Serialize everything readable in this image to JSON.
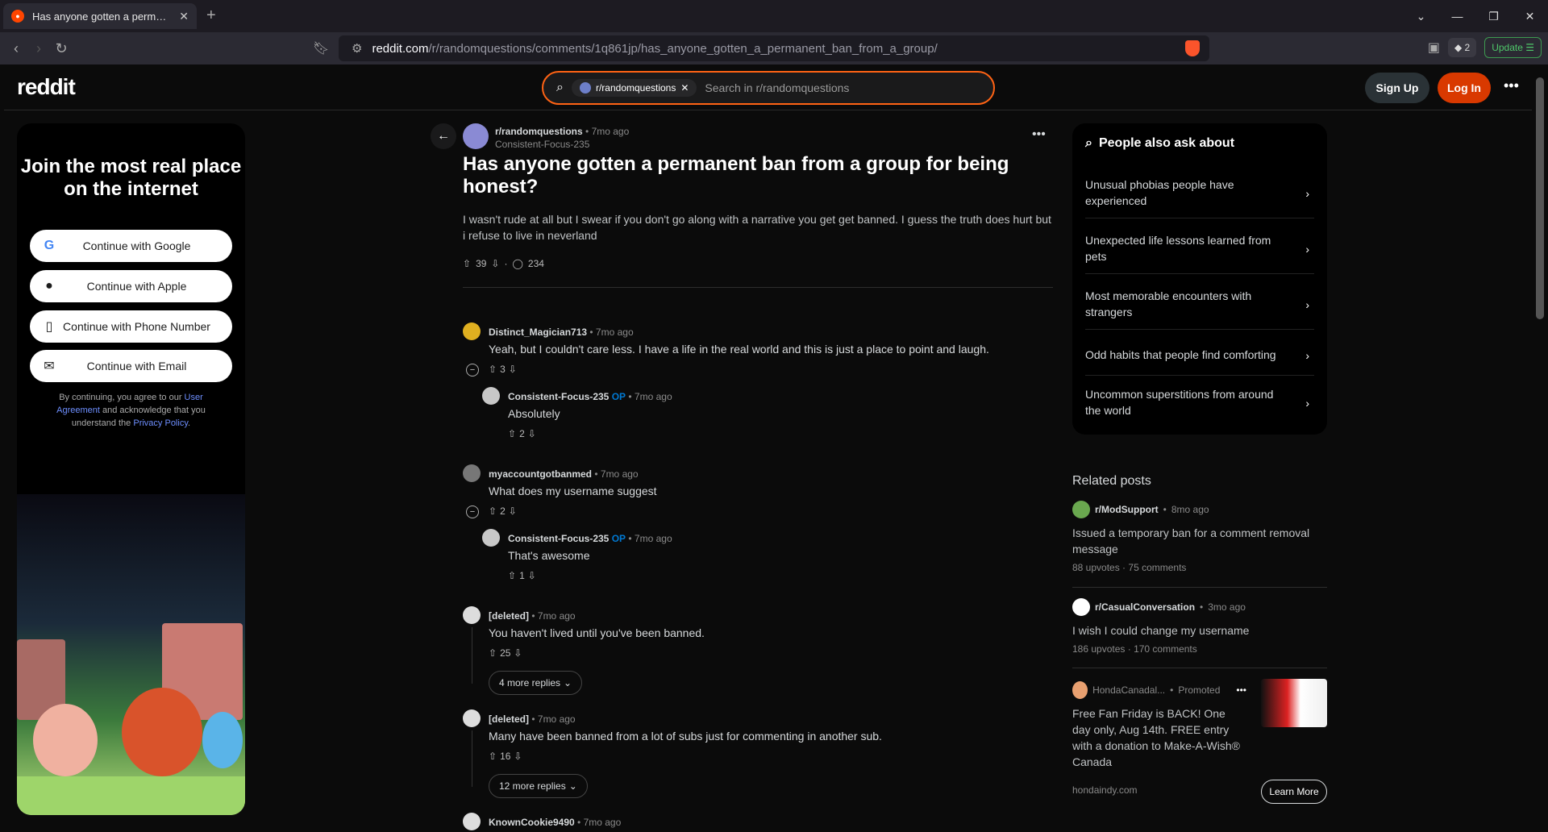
{
  "browser": {
    "tab_title": "Has anyone gotten a permanent ban from a group for being honest?",
    "url_host": "reddit.com",
    "url_path": "/r/randomquestions/comments/1q861jp/has_anyone_gotten_a_permanent_ban_from_a_group/",
    "new_tab": "+",
    "close_tab": "✕",
    "shield_count": "2",
    "update_label": "Update"
  },
  "header": {
    "logo": "reddit",
    "search_subreddit": "r/randomquestions",
    "search_placeholder": "Search in r/randomquestions",
    "signup": "Sign Up",
    "login": "Log In"
  },
  "promo": {
    "heading": "Join the most real place on the internet",
    "buttons": [
      {
        "label": "Continue with Google",
        "icon": "google-icon"
      },
      {
        "label": "Continue with Apple",
        "icon": "apple-icon"
      },
      {
        "label": "Continue with Phone Number",
        "icon": "phone-icon"
      },
      {
        "label": "Continue with Email",
        "icon": "email-icon"
      }
    ],
    "agree_prefix": "By continuing, you agree to our ",
    "agree_link1": "User Agreement",
    "agree_mid": " and acknowledge that you understand the ",
    "agree_link2": "Privacy Policy",
    "agree_suffix": "."
  },
  "post": {
    "subreddit": "r/randomquestions",
    "time": "7mo ago",
    "author": "Consistent-Focus-235",
    "title": "Has anyone gotten a permanent ban from a group for being honest?",
    "body": "I wasn't rude at all but I swear if you don't go along with a narrative you get get banned. I guess the truth does hurt but i refuse to live in neverland",
    "votes": "39",
    "comments": "234"
  },
  "comments": [
    {
      "author": "Distinct_Magician713",
      "time": "7mo ago",
      "op": "",
      "text": "Yeah, but I couldn't care less. I have a life in the real world and this is just a place to point and laugh.",
      "votes": "3"
    },
    {
      "author": "Consistent-Focus-235",
      "time": "7mo ago",
      "op": "OP",
      "text": "Absolutely",
      "votes": "2"
    },
    {
      "author": "myaccountgotbanmed",
      "time": "7mo ago",
      "op": "",
      "text": "What does my username suggest",
      "votes": "2"
    },
    {
      "author": "Consistent-Focus-235",
      "time": "7mo ago",
      "op": "OP",
      "text": "That's awesome",
      "votes": "1"
    },
    {
      "author": "[deleted]",
      "time": "7mo ago",
      "op": "",
      "text": "You haven't lived until you've been banned.",
      "votes": "25",
      "more": "4 more replies"
    },
    {
      "author": "[deleted]",
      "time": "7mo ago",
      "op": "",
      "text": "Many have been banned from a lot of subs just for commenting in another sub.",
      "votes": "16",
      "more": "12 more replies"
    },
    {
      "author": "KnownCookie9490",
      "time": "7mo ago",
      "op": "",
      "text": "",
      "votes": ""
    }
  ],
  "sidebar": {
    "ask_title": "People also ask about",
    "ask_items": [
      "Unusual phobias people have experienced",
      "Unexpected life lessons learned from pets",
      "Most memorable encounters with strangers",
      "Odd habits that people find comforting",
      "Uncommon superstitions from around the world"
    ],
    "related_title": "Related posts",
    "related": [
      {
        "sub": "r/ModSupport",
        "time": "8mo ago",
        "title": "Issued a temporary ban for a comment removal message",
        "upvotes": "88 upvotes",
        "comments": "75 comments"
      },
      {
        "sub": "r/CasualConversation",
        "time": "3mo ago",
        "title": "I wish I could change my username",
        "upvotes": "186 upvotes",
        "comments": "170 comments"
      }
    ],
    "ad": {
      "sponsor": "HondaCanadal...",
      "promoted": "Promoted",
      "title": "Free Fan Friday is BACK! One day only, Aug 14th. FREE entry with a donation to Make-A-Wish® Canada",
      "domain": "hondaindy.com",
      "cta": "Learn More"
    }
  },
  "colors": {
    "accent": "#ff4500",
    "login": "#d93900",
    "op": "#0079d3"
  }
}
